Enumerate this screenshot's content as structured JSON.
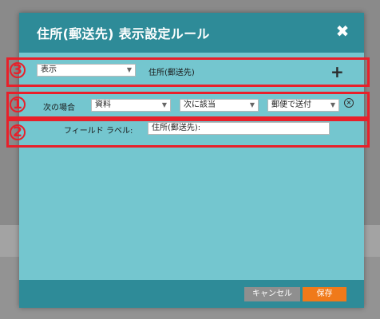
{
  "dialog": {
    "title": "住所(郵送先) 表示設定ルール",
    "close_glyph": "✖"
  },
  "rule_display": {
    "action_select": "表示",
    "target_label": "住所(郵送先)",
    "add_glyph": "+"
  },
  "rule_condition": {
    "prefix_label": "次の場合",
    "field_select": "資料",
    "operator_select": "次に該当",
    "value_select": "郵便で送付",
    "remove_glyph": "×"
  },
  "rule_label": {
    "field_label_text": "フィールド ラベル:",
    "field_label_value": "住所(郵送先):"
  },
  "footer": {
    "cancel_label": "キャンセル",
    "save_label": "保存"
  },
  "annotations": {
    "n1": "1",
    "n2": "2",
    "n3": "3"
  },
  "colors": {
    "header": "#2e8b98",
    "body": "#74c6cf",
    "save_button": "#f07a1a",
    "cancel_button": "#8f8f8f",
    "annotation": "#e8202a"
  }
}
